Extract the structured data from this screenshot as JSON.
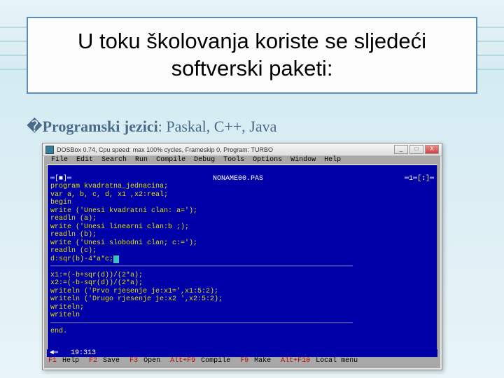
{
  "slide": {
    "title": "U toku školovanja koriste se sljedeći softverski paketi:",
    "subtitle_prefix": "�",
    "subtitle_bold": "Programski jezici",
    "subtitle_rest": ": Paskal, C++, Java"
  },
  "dosbox": {
    "titlebar": "DOSBox 0.74, Cpu speed: max 100% cycles, Frameskip 0, Program: TURBO",
    "win_min": "_",
    "win_max": "□",
    "win_close": "X",
    "menu": {
      "items": [
        "File",
        "Edit",
        "Search",
        "Run",
        "Compile",
        "Debug",
        "Tools",
        "Options",
        "Window",
        "Help"
      ]
    },
    "editor": {
      "corner_left": "═[■]═",
      "filename": "NONAME00.PAS",
      "corner_right": "═1═[↕]═",
      "lines": [
        "program kvadratna_jednacina;",
        "var a, b, c, d, x1 ,x2:real;",
        "begin",
        "write ('Unesi kvadratni clan: a=');",
        "readln (a);",
        "write ('Unesi linearni clan:b ;);",
        "readln (b);",
        "write ('Unesi slobodni clan; c:=');",
        "readln (c);",
        "d:sqr(b)-4*a*c;",
        "",
        "x1:=(-b+sqr(d))/(2*a);",
        "x2:=(-b-sqr(d))/(2*a);",
        "writeln ('Prvo rjesenje je:x1=',x1:5:2);",
        "writeln ('Drugo rjesenje je:x2 ',x2:5:2);",
        "writeln;",
        "writeln",
        "",
        "end."
      ],
      "separator": "────────────────────────────────────────────────────────────────────────",
      "bottom_left": "◄═",
      "position": "19:313",
      "bottom_right": "─═►"
    },
    "status": {
      "items": [
        [
          "F1",
          " Help  "
        ],
        [
          "F2",
          " Save  "
        ],
        [
          "F3",
          " Open  "
        ],
        [
          "Alt+F9",
          " Compile  "
        ],
        [
          "F9",
          " Make  "
        ],
        [
          "Alt+F10",
          " Local menu"
        ]
      ]
    }
  }
}
